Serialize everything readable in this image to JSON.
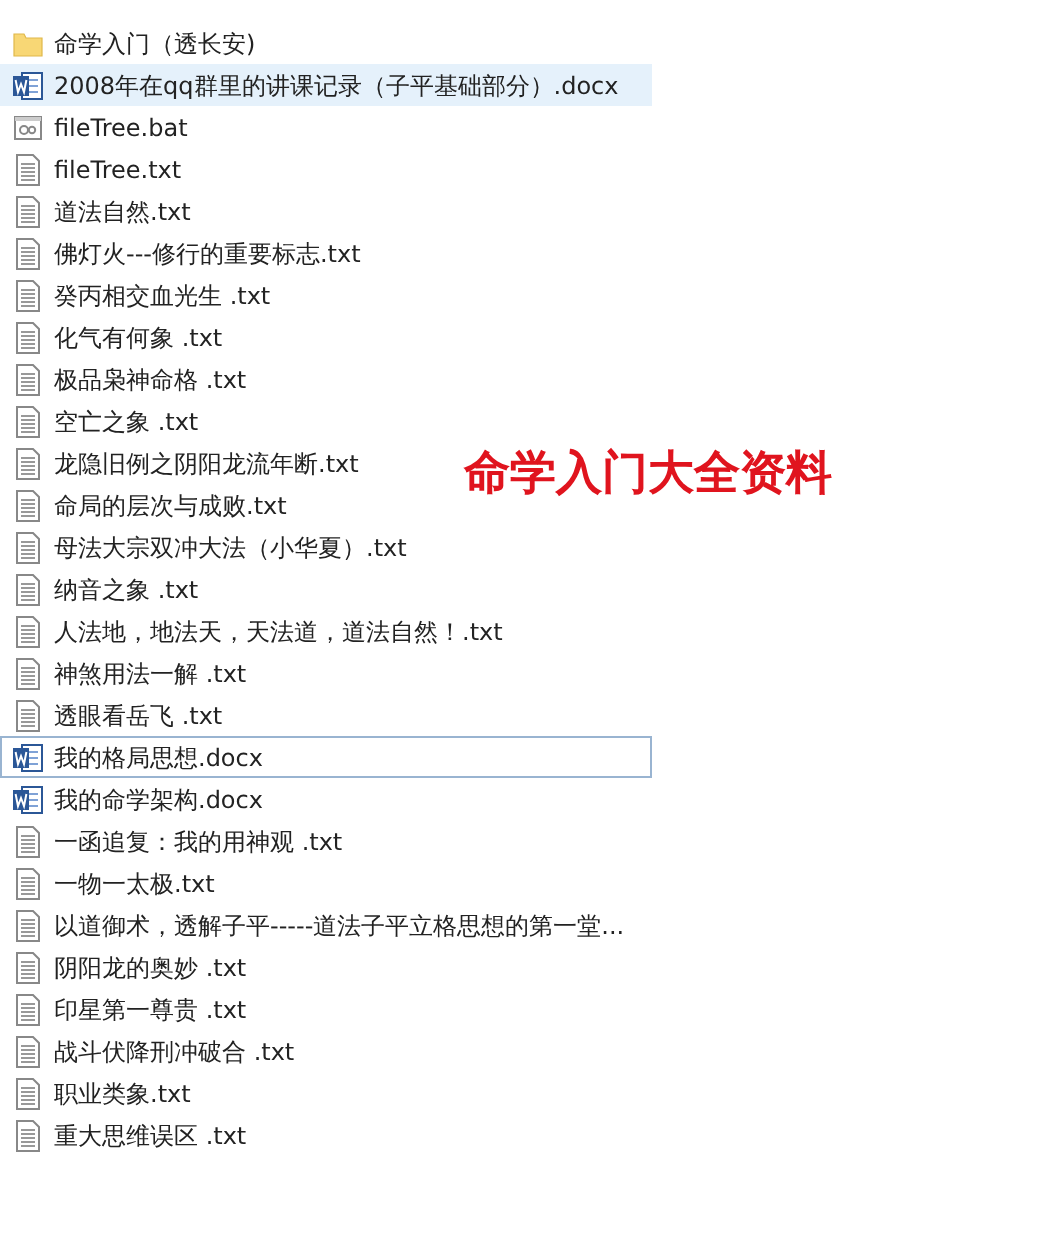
{
  "files": [
    {
      "name": "命学入门（透长安)",
      "kind": "folder",
      "selected": false,
      "focused": false
    },
    {
      "name": "2008年在qq群里的讲课记录（子平基础部分）.docx",
      "kind": "word",
      "selected": true,
      "focused": false
    },
    {
      "name": "fileTree.bat",
      "kind": "bat",
      "selected": false,
      "focused": false
    },
    {
      "name": "fileTree.txt",
      "kind": "txt",
      "selected": false,
      "focused": false
    },
    {
      "name": "道法自然.txt",
      "kind": "txt",
      "selected": false,
      "focused": false
    },
    {
      "name": "佛灯火---修行的重要标志.txt",
      "kind": "txt",
      "selected": false,
      "focused": false
    },
    {
      "name": "癸丙相交血光生 .txt",
      "kind": "txt",
      "selected": false,
      "focused": false
    },
    {
      "name": "化气有何象 .txt",
      "kind": "txt",
      "selected": false,
      "focused": false
    },
    {
      "name": "极品枭神命格 .txt",
      "kind": "txt",
      "selected": false,
      "focused": false
    },
    {
      "name": "空亡之象 .txt",
      "kind": "txt",
      "selected": false,
      "focused": false
    },
    {
      "name": "龙隐旧例之阴阳龙流年断.txt",
      "kind": "txt",
      "selected": false,
      "focused": false
    },
    {
      "name": "命局的层次与成败.txt",
      "kind": "txt",
      "selected": false,
      "focused": false
    },
    {
      "name": "母法大宗双冲大法（小华夏）.txt",
      "kind": "txt",
      "selected": false,
      "focused": false
    },
    {
      "name": "纳音之象 .txt",
      "kind": "txt",
      "selected": false,
      "focused": false
    },
    {
      "name": "人法地，地法天，天法道，道法自然！.txt",
      "kind": "txt",
      "selected": false,
      "focused": false
    },
    {
      "name": "神煞用法一解 .txt",
      "kind": "txt",
      "selected": false,
      "focused": false
    },
    {
      "name": "透眼看岳飞 .txt",
      "kind": "txt",
      "selected": false,
      "focused": false
    },
    {
      "name": "我的格局思想.docx",
      "kind": "word",
      "selected": false,
      "focused": true
    },
    {
      "name": "我的命学架构.docx",
      "kind": "word",
      "selected": false,
      "focused": false
    },
    {
      "name": "一函追复：我的用神观 .txt",
      "kind": "txt",
      "selected": false,
      "focused": false
    },
    {
      "name": "一物一太极.txt",
      "kind": "txt",
      "selected": false,
      "focused": false
    },
    {
      "name": "以道御术，透解子平-----道法子平立格思想的第一堂...",
      "kind": "txt",
      "selected": false,
      "focused": false
    },
    {
      "name": "阴阳龙的奥妙 .txt",
      "kind": "txt",
      "selected": false,
      "focused": false
    },
    {
      "name": "印星第一尊贵 .txt",
      "kind": "txt",
      "selected": false,
      "focused": false
    },
    {
      "name": "战斗伏降刑冲破合 .txt",
      "kind": "txt",
      "selected": false,
      "focused": false
    },
    {
      "name": "职业类象.txt",
      "kind": "txt",
      "selected": false,
      "focused": false
    },
    {
      "name": "重大思维误区 .txt",
      "kind": "txt",
      "selected": false,
      "focused": false
    }
  ],
  "overlay_title": "命学入门大全资料"
}
